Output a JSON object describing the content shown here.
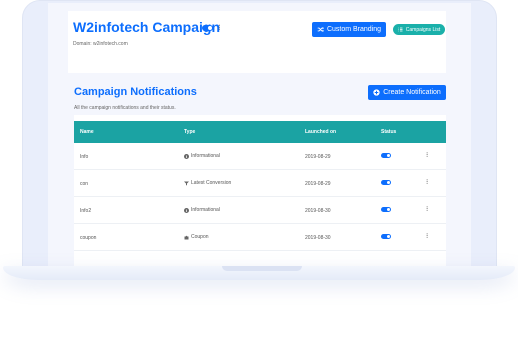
{
  "header": {
    "title": "W2infotech Campaign",
    "more_glyph": "⁝",
    "domain": "Domain: w2infotech.com",
    "custom_branding_label": "Custom Branding",
    "campaigns_list_label": "Campaigns List",
    "campaign_enabled": true
  },
  "section": {
    "title": "Campaign Notifications",
    "subtitle": "All the campaign notifications and their status.",
    "create_label": "Create Notification"
  },
  "table": {
    "columns": [
      "Name",
      "Type",
      "Launched on",
      "Status"
    ],
    "rows": [
      {
        "name": "Info",
        "type": "Informational",
        "type_icon": "info-icon",
        "launched": "2019-08-29",
        "status": true
      },
      {
        "name": "con",
        "type": "Latest Conversion",
        "type_icon": "filter-icon",
        "launched": "2019-08-29",
        "status": true
      },
      {
        "name": "Info2",
        "type": "Informational",
        "type_icon": "info-icon",
        "launched": "2019-08-30",
        "status": true
      },
      {
        "name": "coupon",
        "type": "Coupon",
        "type_icon": "puzzle-icon",
        "launched": "2019-08-30",
        "status": true
      }
    ]
  },
  "colors": {
    "primary": "#0d6efd",
    "teal": "#1ba3a3",
    "campaigns_button": "#1ab0aa"
  }
}
